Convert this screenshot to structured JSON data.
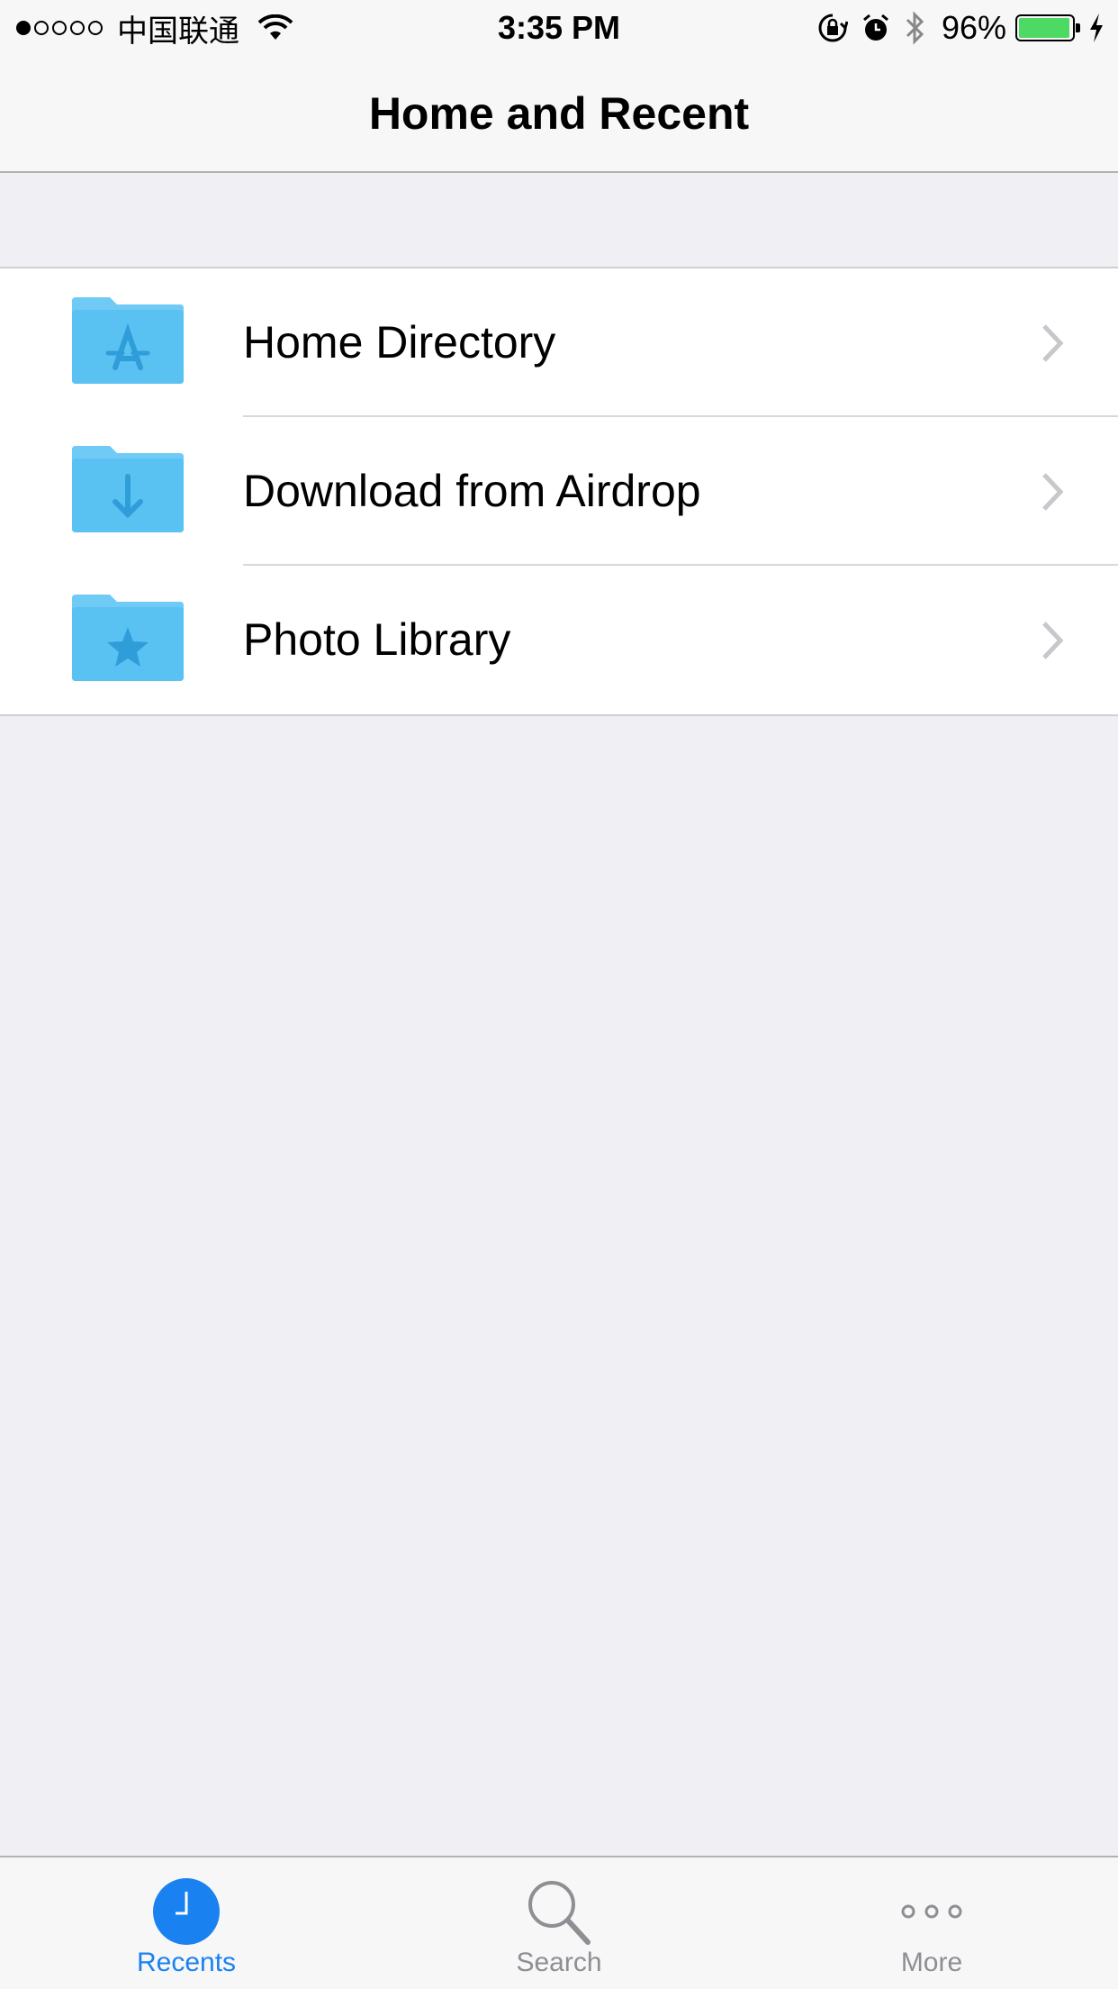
{
  "status_bar": {
    "carrier": "中国联通",
    "time": "3:35 PM",
    "battery_percent": "96%",
    "battery_level": 0.96,
    "battery_color": "#4cd964"
  },
  "nav": {
    "title": "Home and Recent"
  },
  "list": {
    "items": [
      {
        "label": "Home Directory",
        "icon": "app-store-folder-icon"
      },
      {
        "label": "Download from Airdrop",
        "icon": "download-folder-icon"
      },
      {
        "label": "Photo Library",
        "icon": "star-folder-icon"
      }
    ]
  },
  "tab_bar": {
    "tabs": [
      {
        "label": "Recents",
        "icon": "clock-icon",
        "active": true
      },
      {
        "label": "Search",
        "icon": "search-icon",
        "active": false
      },
      {
        "label": "More",
        "icon": "more-icon",
        "active": false
      }
    ]
  },
  "colors": {
    "accent": "#1a82f0",
    "folder": "#5ac1f3",
    "folder_tab": "#6fcaf5",
    "folder_glyph": "#2f9ed8",
    "background": "#efeff4"
  }
}
